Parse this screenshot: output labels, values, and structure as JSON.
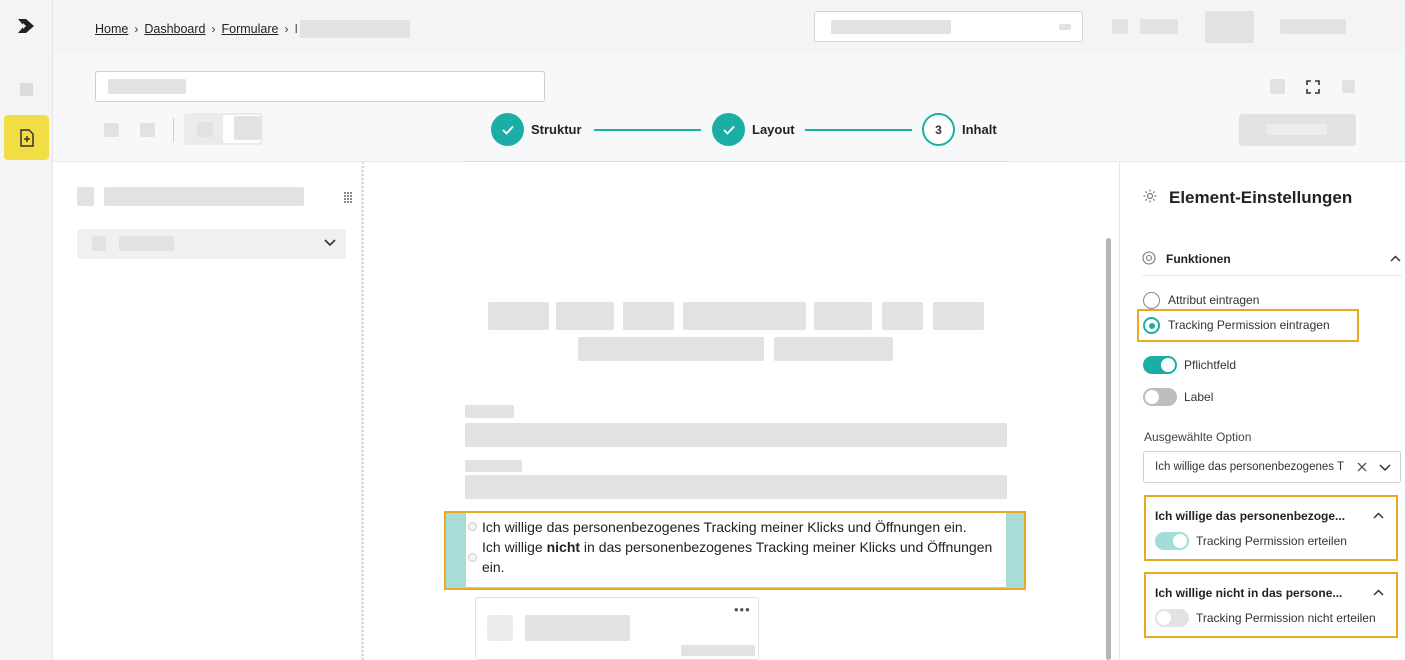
{
  "breadcrumb": {
    "home": "Home",
    "dashboard": "Dashboard",
    "formulare": "Formulare",
    "current": "I"
  },
  "stepper": {
    "step1": "Struktur",
    "step2": "Layout",
    "step3_number": "3",
    "step3": "Inhalt"
  },
  "canvas": {
    "consent_yes": "Ich willige das personenbezogenes Tracking meiner Klicks und Öffnungen ein.",
    "consent_no_prefix": "Ich willige ",
    "consent_no_bold": "nicht",
    "consent_no_suffix": " in das personenbezogenes Tracking meiner Klicks und Öffnungen",
    "consent_no_wrap": "ein."
  },
  "settings": {
    "title": "Element-Einstellungen",
    "section": "Funktionen",
    "radio_attribute": "Attribut eintragen",
    "radio_tracking": "Tracking Permission eintragen",
    "toggle_required": "Pflichtfeld",
    "toggle_label": "Label",
    "selected_option_label": "Ausgewählte Option",
    "selected_option_value": "Ich willige das personenbezogenes T",
    "option1_title": "Ich willige das personenbezoge...",
    "option1_toggle": "Tracking Permission erteilen",
    "option2_title": "Ich willige nicht in das persone...",
    "option2_toggle": "Tracking Permission nicht erteilen"
  },
  "colors": {
    "accent": "#1aaea5",
    "highlight": "#e8aa22",
    "active_nav": "#f3dd45"
  },
  "icons": {
    "logo": "brand-logo-icon",
    "new_form": "file-plus-icon",
    "fullscreen": "fullscreen-icon",
    "drag": "drag-grid-icon",
    "chevron": "chevron-down-icon",
    "gear": "gear-icon",
    "target": "target-icon",
    "more": "more-dots-icon",
    "check": "check-icon",
    "clear": "close-icon"
  }
}
